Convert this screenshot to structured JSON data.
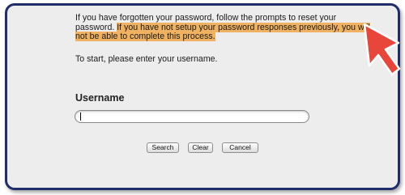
{
  "intro": {
    "plain": "If you have forgotten your password, follow the prompts to reset your password. ",
    "highlighted": "If you have not setup your password responses previously, you will not be able to complete this process."
  },
  "start_text": "To start, please enter your username.",
  "username": {
    "label": "Username",
    "value": ""
  },
  "buttons": {
    "search": "Search",
    "clear": "Clear",
    "cancel": "Cancel"
  },
  "colors": {
    "highlight": "#f0b260",
    "arrow": "#e8463b",
    "frame_border": "#1f2d6b"
  },
  "icons": {
    "pointer": "arrow-pointer-icon"
  }
}
